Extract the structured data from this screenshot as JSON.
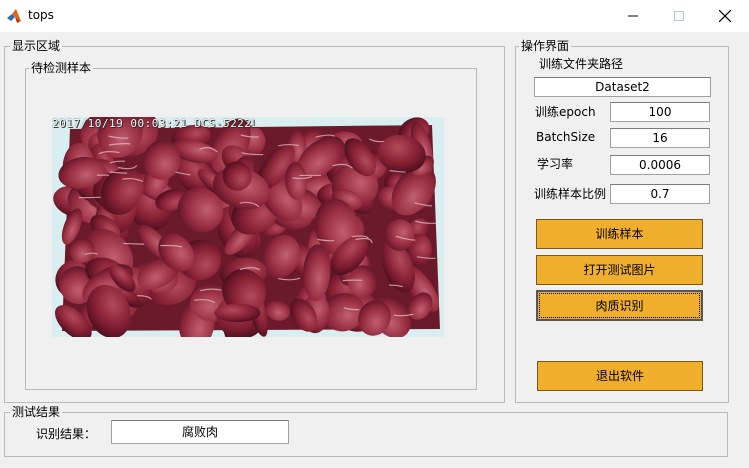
{
  "window": {
    "title": "tops",
    "controls": [
      "minimize-icon",
      "maximize-icon",
      "close-icon"
    ]
  },
  "display_area": {
    "legend": "显示区域",
    "sample_panel": {
      "legend": "待检测样本",
      "image": {
        "overlay_text": "2017/10/19 00:03:21  DCS-5222L",
        "content": "meat-photo"
      }
    }
  },
  "operation": {
    "legend": "操作界面",
    "path_label": "训练文件夹路径",
    "path_value": "Dataset2",
    "params": [
      {
        "label": "训练epoch",
        "value": "100"
      },
      {
        "label": "BatchSize",
        "value": "16"
      },
      {
        "label": "学习率",
        "value": "0.0006"
      },
      {
        "label": "训练样本比例",
        "value": "0.7"
      }
    ],
    "buttons": {
      "train": "训练样本",
      "open_test": "打开测试图片",
      "identify": "肉质识别",
      "exit": "退出软件"
    }
  },
  "result": {
    "legend": "测试结果",
    "label": "识别结果：",
    "value": "腐败肉"
  },
  "colors": {
    "button": "#efaf2c",
    "background": "#f0f0f0",
    "close_icon": "#000000"
  }
}
